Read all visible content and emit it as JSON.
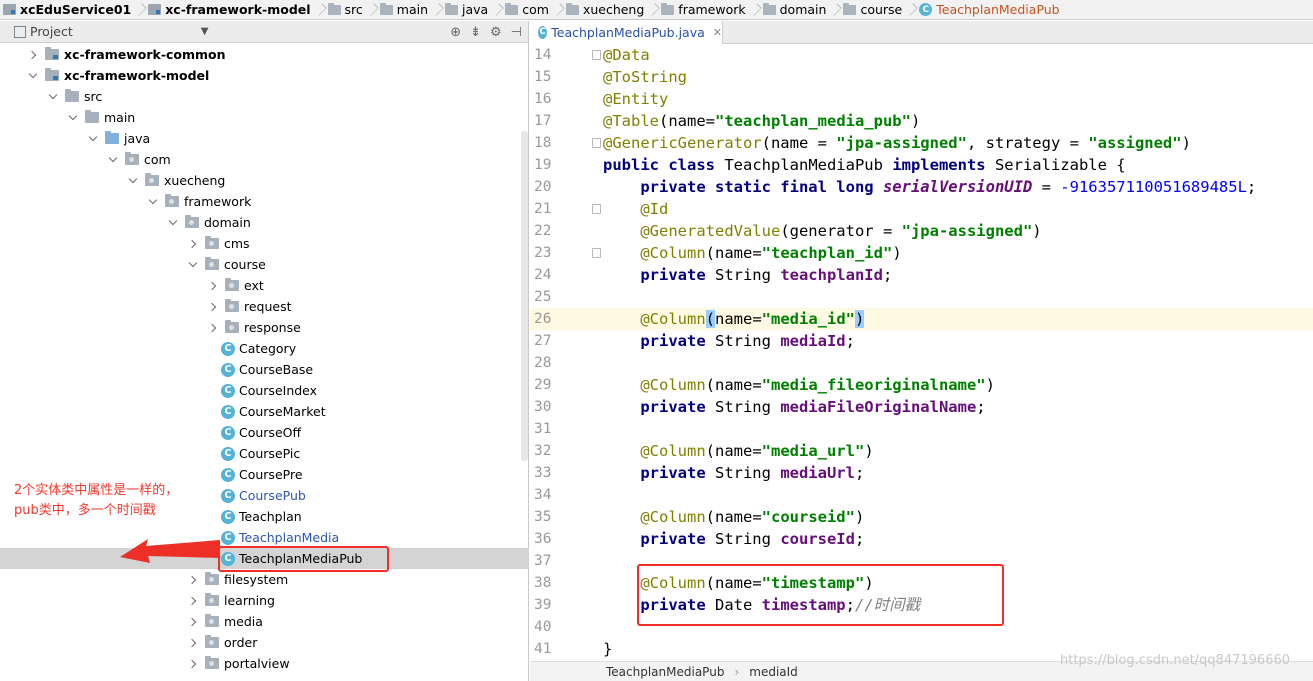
{
  "breadcrumb": [
    {
      "label": "xcEduService01",
      "icon": "module-folder-icon",
      "bold": true
    },
    {
      "label": "xc-framework-model",
      "icon": "module-folder-icon",
      "bold": true
    },
    {
      "label": "src",
      "icon": "folder-icon"
    },
    {
      "label": "main",
      "icon": "folder-icon"
    },
    {
      "label": "java",
      "icon": "folder-icon"
    },
    {
      "label": "com",
      "icon": "folder-icon"
    },
    {
      "label": "xuecheng",
      "icon": "folder-icon"
    },
    {
      "label": "framework",
      "icon": "folder-icon"
    },
    {
      "label": "domain",
      "icon": "folder-icon"
    },
    {
      "label": "course",
      "icon": "folder-icon"
    },
    {
      "label": "TeachplanMediaPub",
      "icon": "class-icon"
    }
  ],
  "project": {
    "title": "Project",
    "tree": [
      {
        "label": "xc-framework-common",
        "indent": 0,
        "arrow": "right",
        "icon": "module",
        "bold": true
      },
      {
        "label": "xc-framework-model",
        "indent": 0,
        "arrow": "down",
        "icon": "module",
        "bold": true
      },
      {
        "label": "src",
        "indent": 1,
        "arrow": "down",
        "icon": "folder"
      },
      {
        "label": "main",
        "indent": 2,
        "arrow": "down",
        "icon": "folder"
      },
      {
        "label": "java",
        "indent": 3,
        "arrow": "down",
        "icon": "source"
      },
      {
        "label": "com",
        "indent": 4,
        "arrow": "down",
        "icon": "package"
      },
      {
        "label": "xuecheng",
        "indent": 5,
        "arrow": "down",
        "icon": "package"
      },
      {
        "label": "framework",
        "indent": 6,
        "arrow": "down",
        "icon": "package"
      },
      {
        "label": "domain",
        "indent": 7,
        "arrow": "down",
        "icon": "package"
      },
      {
        "label": "cms",
        "indent": 8,
        "arrow": "right",
        "icon": "package"
      },
      {
        "label": "course",
        "indent": 8,
        "arrow": "down",
        "icon": "package"
      },
      {
        "label": "ext",
        "indent": 9,
        "arrow": "right",
        "icon": "package"
      },
      {
        "label": "request",
        "indent": 9,
        "arrow": "right",
        "icon": "package"
      },
      {
        "label": "response",
        "indent": 9,
        "arrow": "right",
        "icon": "package"
      },
      {
        "label": "Category",
        "indent": 9,
        "arrow": "none",
        "icon": "class"
      },
      {
        "label": "CourseBase",
        "indent": 9,
        "arrow": "none",
        "icon": "class"
      },
      {
        "label": "CourseIndex",
        "indent": 9,
        "arrow": "none",
        "icon": "class"
      },
      {
        "label": "CourseMarket",
        "indent": 9,
        "arrow": "none",
        "icon": "class"
      },
      {
        "label": "CourseOff",
        "indent": 9,
        "arrow": "none",
        "icon": "class"
      },
      {
        "label": "CoursePic",
        "indent": 9,
        "arrow": "none",
        "icon": "class"
      },
      {
        "label": "CoursePre",
        "indent": 9,
        "arrow": "none",
        "icon": "class"
      },
      {
        "label": "CoursePub",
        "indent": 9,
        "arrow": "none",
        "icon": "class",
        "blue": true
      },
      {
        "label": "Teachplan",
        "indent": 9,
        "arrow": "none",
        "icon": "class"
      },
      {
        "label": "TeachplanMedia",
        "indent": 9,
        "arrow": "none",
        "icon": "class",
        "blue": true
      },
      {
        "label": "TeachplanMediaPub",
        "indent": 9,
        "arrow": "none",
        "icon": "class",
        "selected": true
      },
      {
        "label": "filesystem",
        "indent": 8,
        "arrow": "right",
        "icon": "package"
      },
      {
        "label": "learning",
        "indent": 8,
        "arrow": "right",
        "icon": "package"
      },
      {
        "label": "media",
        "indent": 8,
        "arrow": "right",
        "icon": "package"
      },
      {
        "label": "order",
        "indent": 8,
        "arrow": "right",
        "icon": "package"
      },
      {
        "label": "portalview",
        "indent": 8,
        "arrow": "right",
        "icon": "package"
      }
    ]
  },
  "annotation": {
    "line1": "2个实体类中属性是一样的，",
    "line2": "pub类中，多一个时间戳",
    "arrow_color": "#ee2f25"
  },
  "editor": {
    "tab_label": "TeachplanMediaPub.java",
    "current_line": 26,
    "lines": [
      {
        "n": "14",
        "fold": true,
        "tokens": [
          [
            "an",
            "@Data"
          ]
        ]
      },
      {
        "n": "15",
        "tokens": [
          [
            "an",
            "@ToString"
          ]
        ]
      },
      {
        "n": "16",
        "tokens": [
          [
            "an",
            "@Entity"
          ]
        ]
      },
      {
        "n": "17",
        "tokens": [
          [
            "an",
            "@Table"
          ],
          [
            "pl",
            "(name="
          ],
          [
            "str",
            "\"teachplan_media_pub\""
          ],
          [
            "pl",
            ")"
          ]
        ]
      },
      {
        "n": "18",
        "fold": true,
        "tokens": [
          [
            "an",
            "@GenericGenerator"
          ],
          [
            "pl",
            "(name = "
          ],
          [
            "str",
            "\"jpa-assigned\""
          ],
          [
            "pl",
            ", strategy = "
          ],
          [
            "str",
            "\"assigned\""
          ],
          [
            "pl",
            ")"
          ]
        ]
      },
      {
        "n": "19",
        "tokens": [
          [
            "kw",
            "public class "
          ],
          [
            "pl",
            "TeachplanMediaPub "
          ],
          [
            "kw",
            "implements "
          ],
          [
            "pl",
            "Serializable {"
          ]
        ]
      },
      {
        "n": "20",
        "tokens": [
          [
            "pl",
            "    "
          ],
          [
            "kw",
            "private static final long "
          ],
          [
            "sfld",
            "serialVersionUID"
          ],
          [
            "pl",
            " = "
          ],
          [
            "num",
            "-916357110051689485L"
          ],
          [
            "pl",
            ";"
          ]
        ]
      },
      {
        "n": "21",
        "fold": true,
        "tokens": [
          [
            "pl",
            "    "
          ],
          [
            "an",
            "@Id"
          ]
        ]
      },
      {
        "n": "22",
        "tokens": [
          [
            "pl",
            "    "
          ],
          [
            "an",
            "@GeneratedValue"
          ],
          [
            "pl",
            "(generator = "
          ],
          [
            "str",
            "\"jpa-assigned\""
          ],
          [
            "pl",
            ")"
          ]
        ]
      },
      {
        "n": "23",
        "fold": true,
        "tokens": [
          [
            "pl",
            "    "
          ],
          [
            "an",
            "@Column"
          ],
          [
            "pl",
            "(name="
          ],
          [
            "str",
            "\"teachplan_id\""
          ],
          [
            "pl",
            ")"
          ]
        ]
      },
      {
        "n": "24",
        "tokens": [
          [
            "pl",
            "    "
          ],
          [
            "kw",
            "private "
          ],
          [
            "pl",
            "String "
          ],
          [
            "fld",
            "teachplanId"
          ],
          [
            "pl",
            ";"
          ]
        ]
      },
      {
        "n": "25",
        "tokens": []
      },
      {
        "n": "26",
        "tokens": [
          [
            "pl",
            "    "
          ],
          [
            "an",
            "@Column"
          ],
          [
            "bracket",
            "("
          ],
          [
            "pl",
            "name="
          ],
          [
            "str",
            "\"media_id\""
          ],
          [
            "bracket",
            ")"
          ]
        ]
      },
      {
        "n": "27",
        "tokens": [
          [
            "pl",
            "    "
          ],
          [
            "kw",
            "private "
          ],
          [
            "pl",
            "String "
          ],
          [
            "fld",
            "mediaId"
          ],
          [
            "pl",
            ";"
          ]
        ]
      },
      {
        "n": "28",
        "tokens": []
      },
      {
        "n": "29",
        "tokens": [
          [
            "pl",
            "    "
          ],
          [
            "an",
            "@Column"
          ],
          [
            "pl",
            "(name="
          ],
          [
            "str",
            "\"media_fileoriginalname\""
          ],
          [
            "pl",
            ")"
          ]
        ]
      },
      {
        "n": "30",
        "tokens": [
          [
            "pl",
            "    "
          ],
          [
            "kw",
            "private "
          ],
          [
            "pl",
            "String "
          ],
          [
            "fld",
            "mediaFileOriginalName"
          ],
          [
            "pl",
            ";"
          ]
        ]
      },
      {
        "n": "31",
        "tokens": []
      },
      {
        "n": "32",
        "tokens": [
          [
            "pl",
            "    "
          ],
          [
            "an",
            "@Column"
          ],
          [
            "pl",
            "(name="
          ],
          [
            "str",
            "\"media_url\""
          ],
          [
            "pl",
            ")"
          ]
        ]
      },
      {
        "n": "33",
        "tokens": [
          [
            "pl",
            "    "
          ],
          [
            "kw",
            "private "
          ],
          [
            "pl",
            "String "
          ],
          [
            "fld",
            "mediaUrl"
          ],
          [
            "pl",
            ";"
          ]
        ]
      },
      {
        "n": "34",
        "tokens": []
      },
      {
        "n": "35",
        "tokens": [
          [
            "pl",
            "    "
          ],
          [
            "an",
            "@Column"
          ],
          [
            "pl",
            "(name="
          ],
          [
            "str",
            "\"courseid\""
          ],
          [
            "pl",
            ")"
          ]
        ]
      },
      {
        "n": "36",
        "tokens": [
          [
            "pl",
            "    "
          ],
          [
            "kw",
            "private "
          ],
          [
            "pl",
            "String "
          ],
          [
            "fld",
            "courseId"
          ],
          [
            "pl",
            ";"
          ]
        ]
      },
      {
        "n": "37",
        "tokens": []
      },
      {
        "n": "38",
        "tokens": [
          [
            "pl",
            "    "
          ],
          [
            "an",
            "@Column"
          ],
          [
            "pl",
            "(name="
          ],
          [
            "str",
            "\"timestamp\""
          ],
          [
            "pl",
            ")"
          ]
        ]
      },
      {
        "n": "39",
        "tokens": [
          [
            "pl",
            "    "
          ],
          [
            "kw",
            "private "
          ],
          [
            "pl",
            "Date "
          ],
          [
            "fld",
            "timestamp"
          ],
          [
            "pl",
            ";"
          ],
          [
            "cm",
            "//时间戳"
          ]
        ]
      },
      {
        "n": "40",
        "tokens": []
      },
      {
        "n": "41",
        "tokens": [
          [
            "pl",
            "}"
          ]
        ]
      }
    ]
  },
  "status_crumb": [
    "TeachplanMediaPub",
    "mediaId"
  ],
  "watermark": "https://blog.csdn.net/qq847196660"
}
